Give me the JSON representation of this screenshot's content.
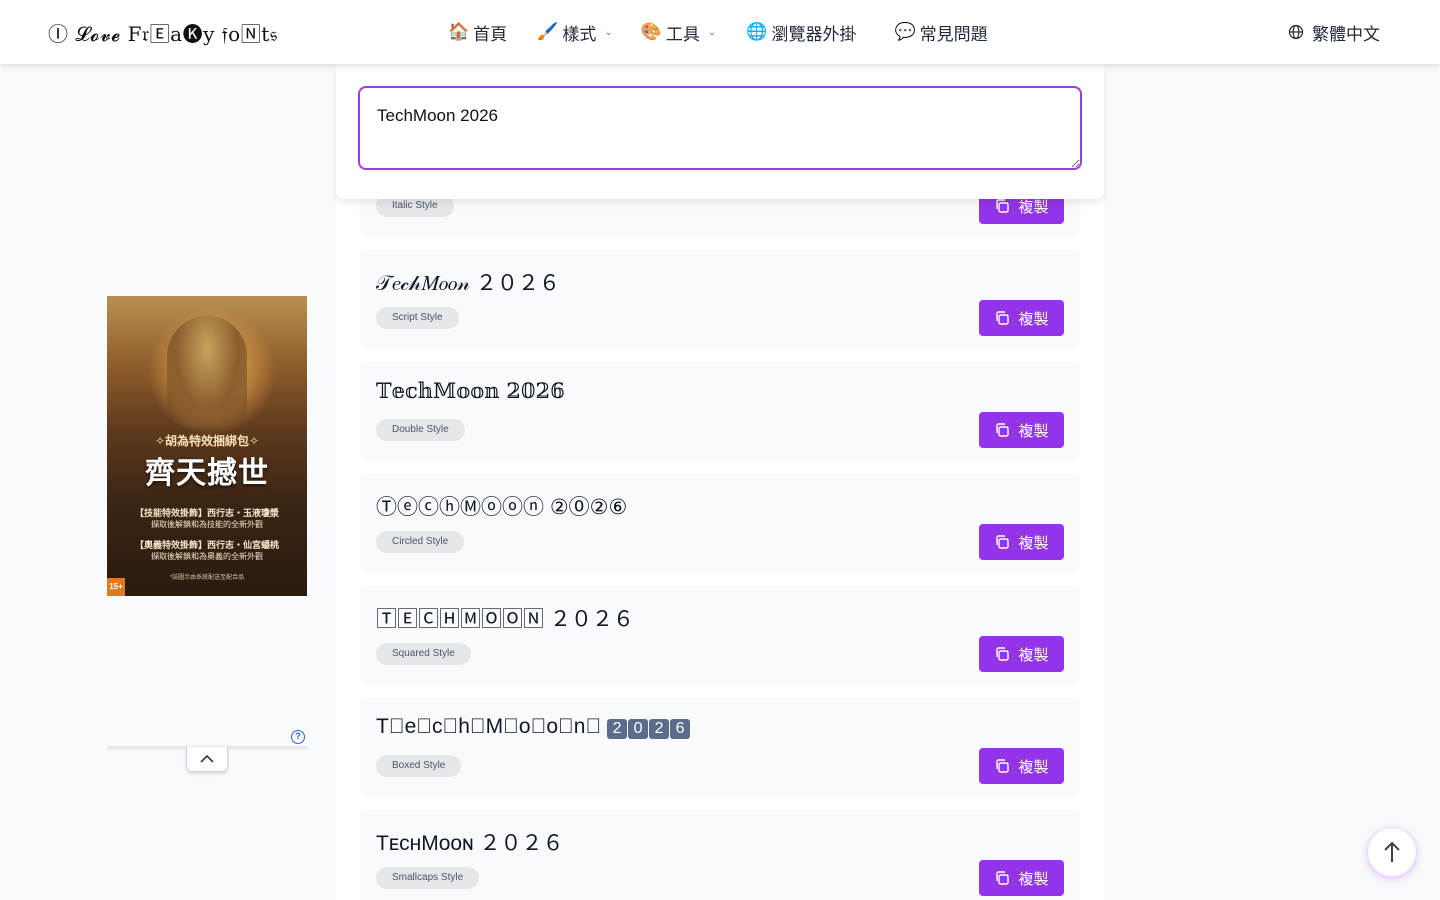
{
  "header": {
    "logo": "Ⓘ 𝓛𝓸𝓿𝓮 F𝔯🄴a🅚y 𝔣o🄽t𝔰",
    "nav": [
      {
        "emoji": "🏠",
        "label": "首頁",
        "has_dropdown": false
      },
      {
        "emoji": "🖌️",
        "label": "樣式",
        "has_dropdown": true
      },
      {
        "emoji": "🎨",
        "label": "工具",
        "has_dropdown": true
      },
      {
        "emoji": "🌐",
        "label": "瀏覽器外掛",
        "has_dropdown": false
      },
      {
        "emoji": "💬",
        "label": "常見問題",
        "has_dropdown": false
      }
    ],
    "language": "繁體中文"
  },
  "input": {
    "value": "TechMoon 2026"
  },
  "styles": [
    {
      "text": "",
      "tag": "Italic Style",
      "copy_label": "複製"
    },
    {
      "text": "𝒯𝑒𝒸𝒽𝑀𝑜𝑜𝓃 ２０２６",
      "tag": "Script Style",
      "copy_label": "複製"
    },
    {
      "text": "𝕋𝕖𝕔𝕙𝕄𝕠𝕠𝕟 𝟚𝟘𝟚𝟞",
      "tag": "Double Style",
      "copy_label": "複製"
    },
    {
      "text": "ⓉⓔⓒⓗⓂⓞⓞⓝ ②⓪②⑥",
      "tag": "Circled Style",
      "copy_label": "複製"
    },
    {
      "text": "🅃🄴🄲🄷🄼🄾🄾🄽 ２０２６",
      "tag": "Squared Style",
      "copy_label": "複製"
    },
    {
      "text": "T⃞e⃞c⃞h⃞M⃞o⃞o⃞n⃞",
      "digits": [
        "2",
        "0",
        "2",
        "6"
      ],
      "tag": "Boxed Style",
      "copy_label": "複製"
    },
    {
      "text": "TᴇᴄʜMᴏᴏɴ ２０２６",
      "tag": "Smallcaps Style",
      "copy_label": "複製"
    }
  ],
  "ad": {
    "subtitle": "✧胡為特效捆綁包✧",
    "title": "齊天撼世",
    "lines": [
      "【技能特效掛飾】西行志・玉液瓊漿",
      "擷取後解鎖和為技能的全新外觀",
      "【奧義特效掛飾】西行志・仙宮蟠桃",
      "擷取後解鎖和為奧義的全新外觀"
    ],
    "footer": "*該圖示由系統配送至配合品",
    "rating": "15+"
  },
  "colors": {
    "accent": "#9333ea",
    "input_border": "#9d3ce0",
    "tag_bg": "#e5e7eb",
    "page_bg": "#f9fafb"
  },
  "icons": {
    "globe": "globe-icon",
    "copy": "copy-icon",
    "arrow_up": "arrow-up-icon",
    "chevron_up": "chevron-up-icon",
    "help": "help-icon"
  }
}
